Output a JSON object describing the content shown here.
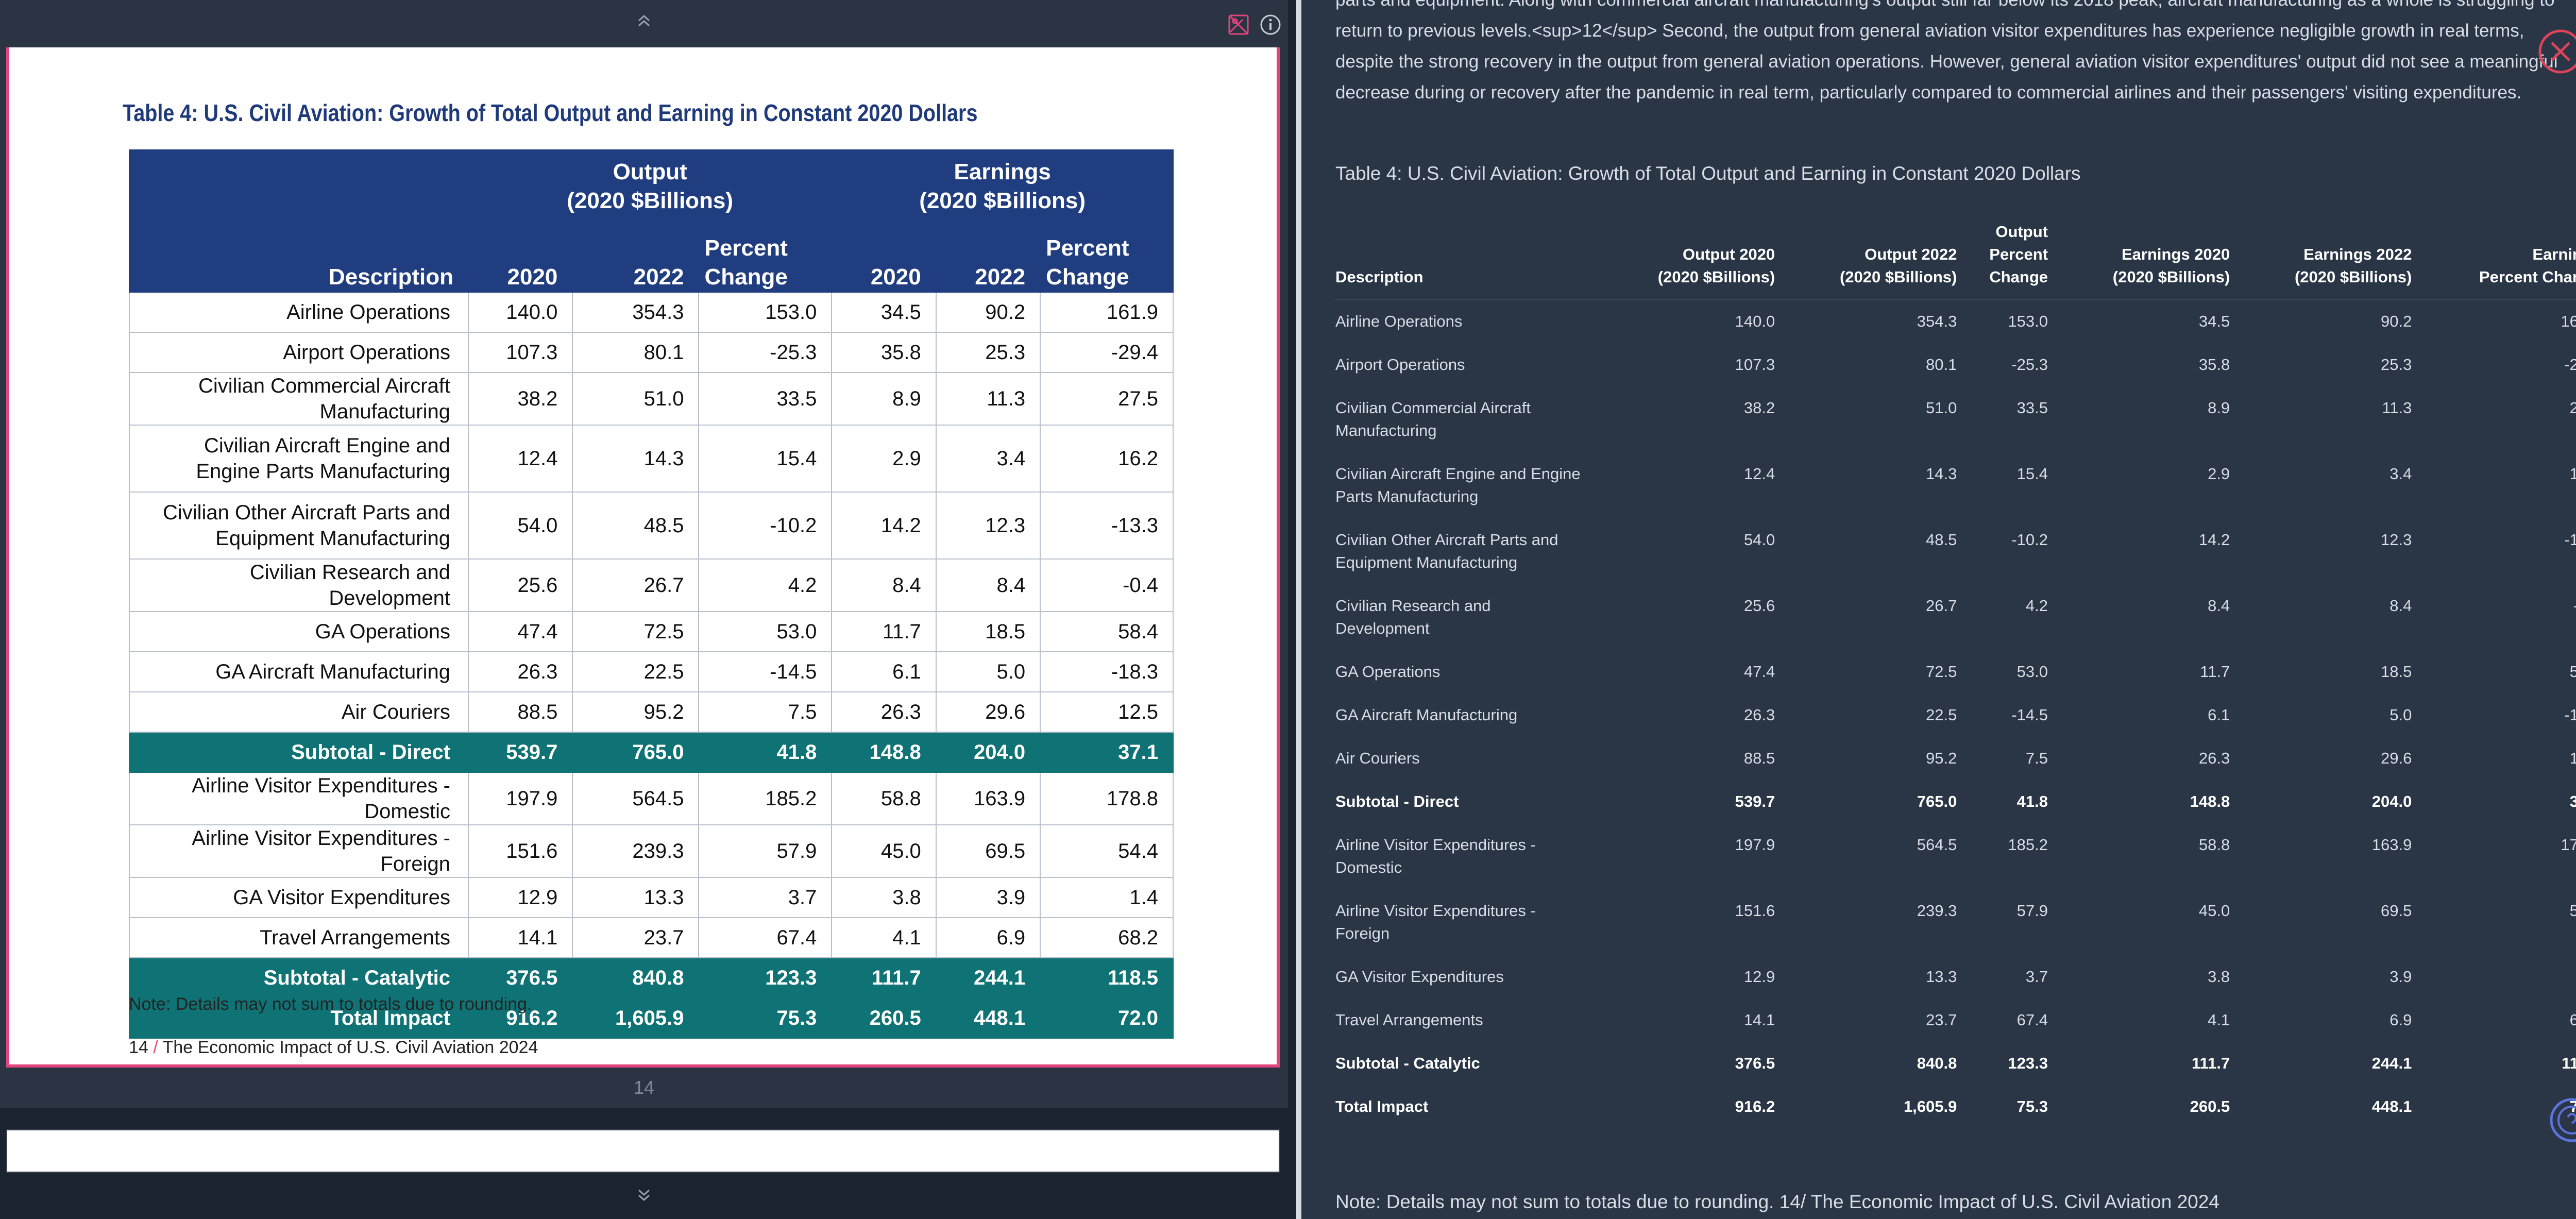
{
  "viewer": {
    "page_number": "14"
  },
  "pdf": {
    "title": "Table 4: U.S. Civil Aviation: Growth of Total Output and Earning in Constant 2020 Dollars",
    "group_output": [
      "Output",
      "(2020 $Billions)"
    ],
    "group_earnings": [
      "Earnings",
      "(2020 $Billions)"
    ],
    "col_description": "Description",
    "col_2020": "2020",
    "col_2022": "2022",
    "col_pct": [
      "Percent",
      "Change"
    ],
    "rows": [
      {
        "desc": "Airline Operations",
        "v": [
          "140.0",
          "354.3",
          "153.0",
          "34.5",
          "90.2",
          "161.9"
        ]
      },
      {
        "desc": "Airport Operations",
        "v": [
          "107.3",
          "80.1",
          "-25.3",
          "35.8",
          "25.3",
          "-29.4"
        ]
      },
      {
        "desc": "Civilian Commercial Aircraft Manufacturing",
        "v": [
          "38.2",
          "51.0",
          "33.5",
          "8.9",
          "11.3",
          "27.5"
        ]
      },
      {
        "desc": "Civilian Aircraft Engine and Engine Parts Manufacturing",
        "v": [
          "12.4",
          "14.3",
          "15.4",
          "2.9",
          "3.4",
          "16.2"
        ]
      },
      {
        "desc": "Civilian Other Aircraft Parts and Equipment Manufacturing",
        "v": [
          "54.0",
          "48.5",
          "-10.2",
          "14.2",
          "12.3",
          "-13.3"
        ]
      },
      {
        "desc": "Civilian Research and Development",
        "v": [
          "25.6",
          "26.7",
          "4.2",
          "8.4",
          "8.4",
          "-0.4"
        ]
      },
      {
        "desc": "GA Operations",
        "v": [
          "47.4",
          "72.5",
          "53.0",
          "11.7",
          "18.5",
          "58.4"
        ]
      },
      {
        "desc": "GA Aircraft Manufacturing",
        "v": [
          "26.3",
          "22.5",
          "-14.5",
          "6.1",
          "5.0",
          "-18.3"
        ]
      },
      {
        "desc": "Air Couriers",
        "v": [
          "88.5",
          "95.2",
          "7.5",
          "26.3",
          "29.6",
          "12.5"
        ]
      },
      {
        "desc": "Subtotal - Direct",
        "v": [
          "539.7",
          "765.0",
          "41.8",
          "148.8",
          "204.0",
          "37.1"
        ],
        "sub": true
      },
      {
        "desc": "Airline Visitor Expenditures - Domestic",
        "v": [
          "197.9",
          "564.5",
          "185.2",
          "58.8",
          "163.9",
          "178.8"
        ]
      },
      {
        "desc": "Airline Visitor Expenditures - Foreign",
        "v": [
          "151.6",
          "239.3",
          "57.9",
          "45.0",
          "69.5",
          "54.4"
        ]
      },
      {
        "desc": "GA Visitor Expenditures",
        "v": [
          "12.9",
          "13.3",
          "3.7",
          "3.8",
          "3.9",
          "1.4"
        ]
      },
      {
        "desc": "Travel Arrangements",
        "v": [
          "14.1",
          "23.7",
          "67.4",
          "4.1",
          "6.9",
          "68.2"
        ]
      },
      {
        "desc": "Subtotal - Catalytic",
        "v": [
          "376.5",
          "840.8",
          "123.3",
          "111.7",
          "244.1",
          "118.5"
        ],
        "sub": true
      },
      {
        "desc": "Total Impact",
        "v": [
          "916.2",
          "1,605.9",
          "75.3",
          "260.5",
          "448.1",
          "72.0"
        ],
        "sub": true
      }
    ],
    "note": "Note: Details may not sum to totals due to rounding.",
    "footer_page": "14",
    "footer_slash": "/",
    "footer_title": "The Economic Impact of U.S. Civil Aviation 2024"
  },
  "extract": {
    "intro": "parts and equipment. Along with commercial aircraft manufacturing's output still far below its 2018 peak, aircraft manufacturing as a whole is struggling to return to previous levels.<sup>12</sup> Second, the output from general aviation visitor expenditures has experience negligible growth in real terms, despite the strong recovery in the output from general aviation operations. However, general aviation visitor expenditures' output did not see a meaningful decrease during or recovery after the pandemic in real term, particularly compared to commercial airlines and their passengers' visiting expenditures.",
    "caption": "Table 4: U.S. Civil Aviation: Growth of Total Output and Earning in Constant 2020 Dollars",
    "headers": [
      [
        "Description"
      ],
      [
        "Output 2020",
        "(2020 $Billions)"
      ],
      [
        "Output 2022",
        "(2020 $Billions)"
      ],
      [
        "Output",
        "Percent",
        "Change"
      ],
      [
        "Earnings 2020",
        "(2020 $Billions)"
      ],
      [
        "Earnings 2022",
        "(2020 $Billions)"
      ],
      [
        "Earnings",
        "Percent Change"
      ]
    ],
    "desc_wrapped": [
      [
        "Airline Operations"
      ],
      [
        "Airport Operations"
      ],
      [
        "Civilian Commercial Aircraft",
        "Manufacturing"
      ],
      [
        "Civilian Aircraft Engine and Engine",
        "Parts Manufacturing"
      ],
      [
        "Civilian Other Aircraft Parts and",
        "Equipment Manufacturing"
      ],
      [
        "Civilian Research and",
        "Development"
      ],
      [
        "GA Operations"
      ],
      [
        "GA Aircraft Manufacturing"
      ],
      [
        "Air Couriers"
      ],
      [
        "Subtotal - Direct"
      ],
      [
        "Airline Visitor Expenditures -",
        "Domestic"
      ],
      [
        "Airline Visitor Expenditures -",
        "Foreign"
      ],
      [
        "GA Visitor Expenditures"
      ],
      [
        "Travel Arrangements"
      ],
      [
        "Subtotal - Catalytic"
      ],
      [
        "Total Impact"
      ]
    ],
    "note": "Note: Details may not sum to totals due to rounding. 14/ The Economic Impact of U.S. Civil Aviation 2024"
  },
  "icons": {
    "image_icon": "image-icon",
    "info_icon": "info-icon",
    "close_icon": "close-icon",
    "help_icon": "help-icon",
    "chevrons": [
      "chevron-up-icon",
      "chevron-down-icon"
    ]
  },
  "colors": {
    "pdf_header": "#203d80",
    "pdf_subtotal": "#0f7274",
    "page_border": "#e2457e",
    "close_red": "#e0435a",
    "help_blue": "#5b74e0"
  }
}
